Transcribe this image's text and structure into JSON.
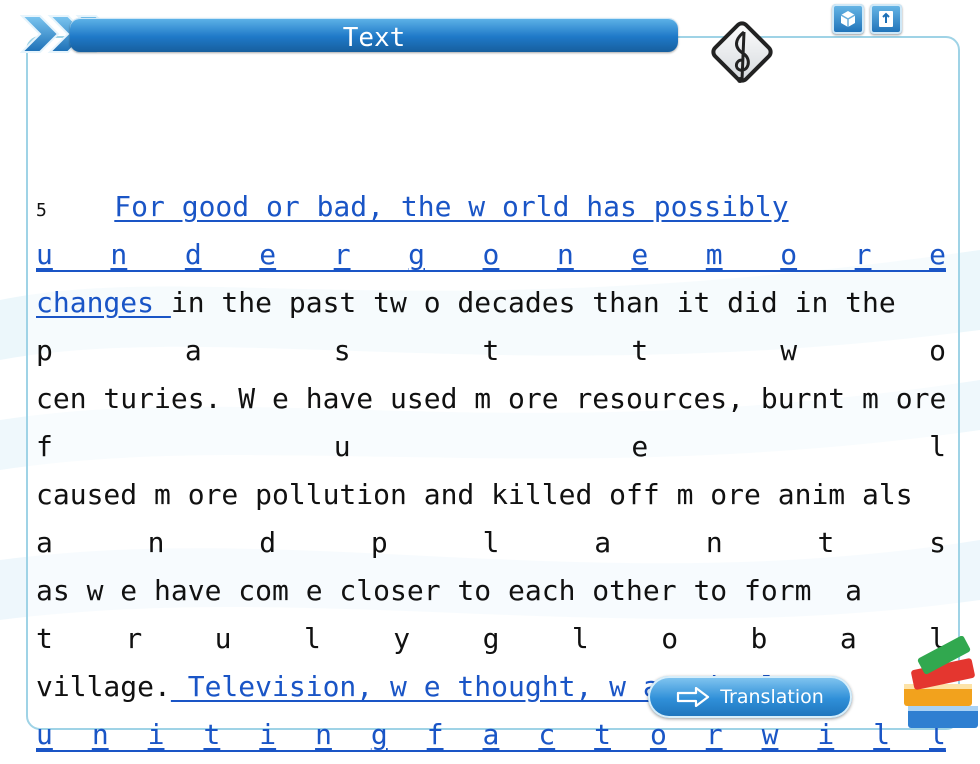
{
  "header": {
    "title": "Text"
  },
  "passage": {
    "line_number": "5",
    "lines": [
      {
        "segments": [
          {
            "text": "For good or bad, the w orld has possibly",
            "underline": true
          }
        ]
      },
      {
        "spread": true,
        "underline": true,
        "letters": [
          "u",
          "n",
          "d",
          "e",
          "r",
          "g",
          "o",
          "n",
          "e",
          "m",
          "o",
          "r",
          "e"
        ]
      },
      {
        "segments": [
          {
            "text": "changes ",
            "underline": true
          },
          {
            "text": "in the past tw o decades than it did in the",
            "underline": false
          }
        ]
      },
      {
        "spread": true,
        "underline": false,
        "letters": [
          "p",
          "a",
          "s",
          "t",
          "t",
          "w",
          "o"
        ]
      },
      {
        "segments": [
          {
            "text": "cen turies. W e have used m ore resources, burnt m ore",
            "underline": false
          }
        ]
      },
      {
        "spread": true,
        "underline": false,
        "letters": [
          "f",
          "u",
          "e",
          "l"
        ]
      },
      {
        "segments": [
          {
            "text": "caused m ore pollution and killed off m ore anim als",
            "underline": false
          }
        ]
      },
      {
        "spread": true,
        "underline": false,
        "letters": [
          "a",
          "n",
          "d",
          "p",
          "l",
          "a",
          "n",
          "t",
          "s"
        ]
      },
      {
        "segments": [
          {
            "text": "as w e have com e closer to each other to form  a",
            "underline": false
          }
        ]
      },
      {
        "spread": true,
        "underline": false,
        "letters": [
          "t",
          "r",
          "u",
          "l",
          "y",
          "g",
          "l",
          "o",
          "b",
          "a",
          "l"
        ]
      },
      {
        "segments": [
          {
            "text": "village.",
            "underline": false
          },
          {
            "text": " Television, w e thought, w as the last",
            "underline": true
          }
        ]
      },
      {
        "spread": true,
        "underline": true,
        "letters": [
          "u",
          "n",
          "i",
          "t",
          "i",
          "n",
          "g",
          "f",
          "a",
          "c",
          "t",
          "o",
          "r",
          "w",
          "i",
          "l",
          "l"
        ]
      }
    ]
  },
  "buttons": {
    "translation_label": "Translation"
  },
  "colors": {
    "title_bar": "#1f79c8",
    "link": "#1a55c6",
    "panel_border": "#9fd3e6"
  },
  "icons": [
    "chevron-arrows-icon",
    "music-clef-icon",
    "cube-icon",
    "book-icon",
    "arrow-right-icon",
    "stacked-books-icon"
  ]
}
